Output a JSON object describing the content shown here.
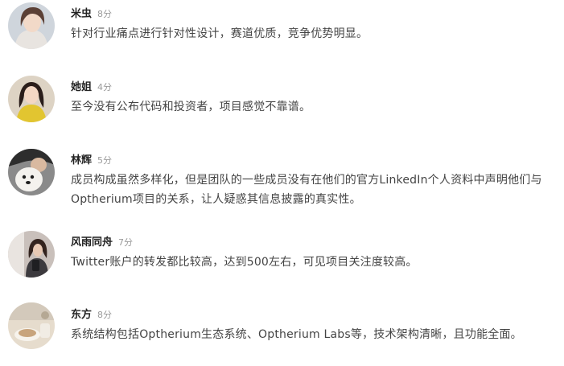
{
  "comments": [
    {
      "name": "米虫",
      "time": "8分",
      "text": "针对行业痛点进行针对性设计，赛道优质，竞争优势明显。"
    },
    {
      "name": "她姐",
      "time": "4分",
      "text": "至今没有公布代码和投资者，项目感觉不靠谱。"
    },
    {
      "name": "林辉",
      "time": "5分",
      "text": "成员构成虽然多样化，但是团队的一些成员没有在他们的官方LinkedIn个人资料中声明他们与Optherium项目的关系，让人疑惑其信息披露的真实性。"
    },
    {
      "name": "风雨同舟",
      "time": "7分",
      "text": "Twitter账户的转发都比较高，达到500左右，可见项目关注度较高。"
    },
    {
      "name": "东方",
      "time": "8分",
      "text": "系统结构包括Optherium生态系统、Optherium Labs等，技术架构清晰，且功能全面。"
    }
  ]
}
